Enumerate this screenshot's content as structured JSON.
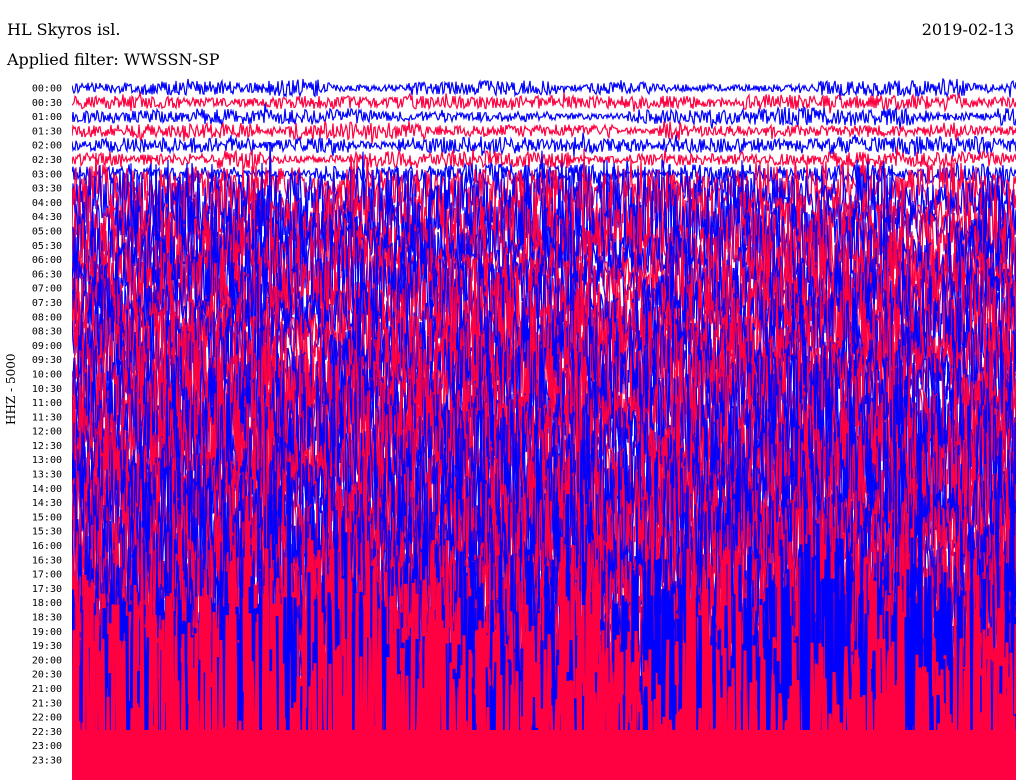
{
  "header": {
    "station": "HL Skyros isl.",
    "filter": "Applied filter: WWSSN-SP",
    "date": "2019-02-13"
  },
  "chart_data": {
    "type": "line",
    "title": "HL Skyros isl.",
    "subtitle": "Applied filter: WWSSN-SP",
    "date": "2019-02-13",
    "ylabel": "HHZ - 5000",
    "colors": [
      "#0000ff",
      "#ff0040"
    ],
    "row_labels": [
      "00:00",
      "00:30",
      "01:00",
      "01:30",
      "02:00",
      "02:30",
      "03:00",
      "03:30",
      "04:00",
      "04:30",
      "05:00",
      "05:30",
      "06:00",
      "06:30",
      "07:00",
      "07:30",
      "08:00",
      "08:30",
      "09:00",
      "09:30",
      "10:00",
      "10:30",
      "11:00",
      "11:30",
      "12:00",
      "12:30",
      "13:00",
      "13:30",
      "14:00",
      "14:30",
      "15:00",
      "15:30",
      "16:00",
      "16:30",
      "17:00",
      "17:30",
      "18:00",
      "18:30",
      "19:00",
      "19:30",
      "20:00",
      "20:30",
      "21:00",
      "21:30",
      "22:00",
      "22:30",
      "23:00",
      "23:30"
    ],
    "relative_amplitude": [
      0.45,
      0.45,
      0.45,
      0.45,
      0.45,
      0.45,
      0.5,
      1.6,
      2.2,
      2.4,
      2.4,
      2.4,
      2.5,
      2.5,
      2.6,
      2.6,
      2.8,
      2.8,
      3,
      3,
      3.2,
      3.3,
      3.4,
      3.5,
      3.6,
      3.6,
      3.7,
      3.8,
      3.8,
      3.9,
      4,
      4,
      4,
      4,
      4.2,
      4.2,
      4.2,
      4.3,
      4.3,
      4.4,
      4.4,
      4.5,
      4.5,
      5,
      10,
      10,
      10,
      10
    ]
  }
}
